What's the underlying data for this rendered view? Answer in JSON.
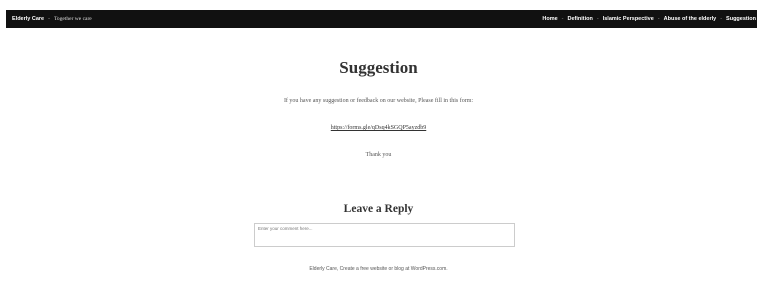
{
  "header": {
    "site_title": "Elderly Care",
    "separator": "-",
    "tagline": "Together we care",
    "nav": [
      {
        "label": "Home"
      },
      {
        "label": "Definition"
      },
      {
        "label": "Islamic Perspective"
      },
      {
        "label": "Abuse of the elderly"
      },
      {
        "label": "Suggestion"
      }
    ],
    "nav_separator": "-"
  },
  "main": {
    "title": "Suggestion",
    "intro": "If you have any suggestion or feedback on our website, Please fill in this form:",
    "form_link": "https://forms.gle/qDsq4kSGQP5ayzdb9",
    "thanks": "Thank you"
  },
  "reply": {
    "title": "Leave a Reply",
    "comment_placeholder": "Enter your comment here..."
  },
  "footer": {
    "text": "Elderly Care, Create a free website or blog at WordPress.com."
  },
  "colors": {
    "topbar_background": "#111111",
    "text": "#333333"
  }
}
